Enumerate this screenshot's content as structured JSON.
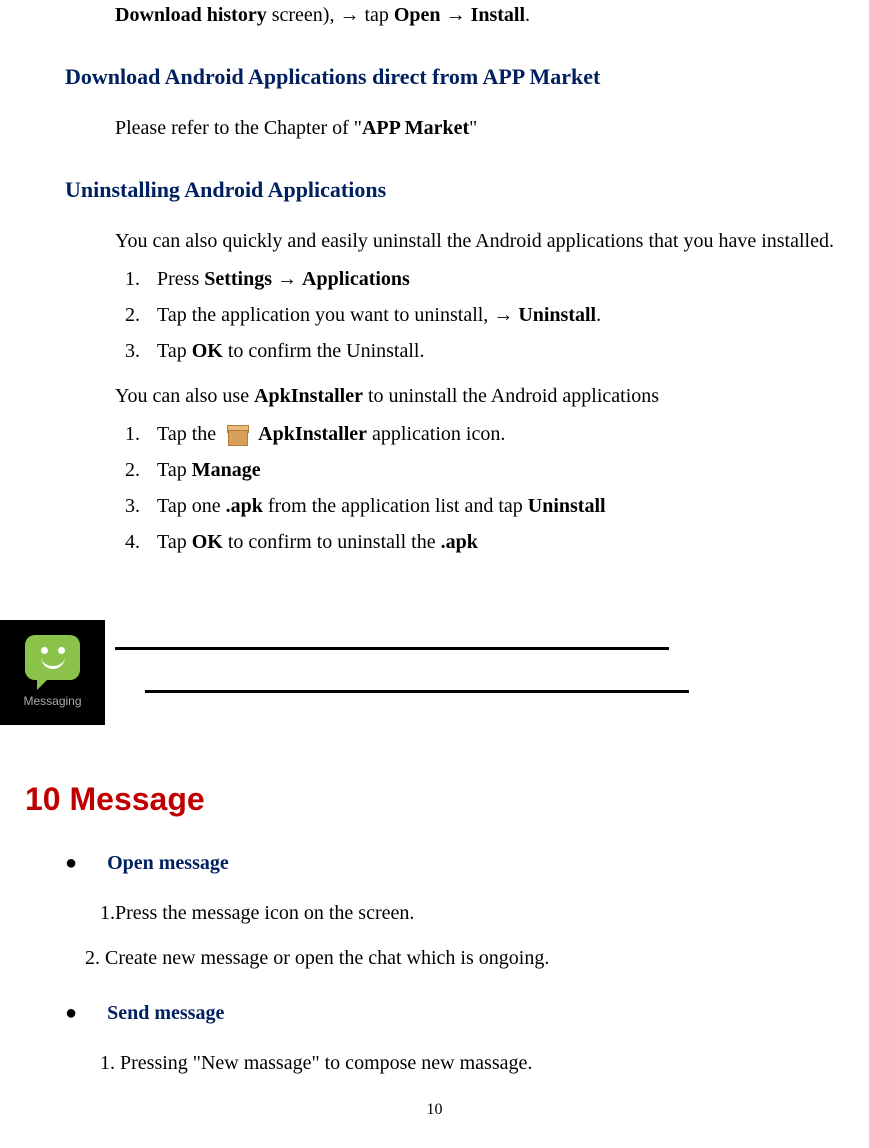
{
  "top_line": {
    "bold1": "Download history",
    "text1": " screen),  ",
    "arrow1": "→",
    "text2": "  tap ",
    "bold2": "Open",
    "text3": "  ",
    "arrow2": "→",
    "text4": "  ",
    "bold3": "Install",
    "text5": "."
  },
  "section1": {
    "heading": "Download Android Applications direct from APP Market",
    "body_pre": "Please refer to the Chapter of \"",
    "body_bold": "APP Market",
    "body_post": "\""
  },
  "section2": {
    "heading": "Uninstalling Android Applications",
    "intro": "You can also quickly and easily uninstall the Android applications that you have installed.",
    "list1": [
      {
        "num": "1.",
        "pre": "Press ",
        "b1": "Settings",
        "mid": "  ",
        "arrow": "→",
        "mid2": "  ",
        "b2": "Applications",
        "post": ""
      },
      {
        "num": "2.",
        "pre": "Tap the application you want to uninstall,  ",
        "arrow": "→",
        "mid2": "  ",
        "b2": "Uninstall",
        "post": "."
      },
      {
        "num": "3.",
        "pre": "Tap ",
        "b1": "OK",
        "post": " to confirm the Uninstall."
      }
    ],
    "intro2_pre": "You can also use ",
    "intro2_bold": "ApkInstaller",
    "intro2_post": " to uninstall the Android applications",
    "list2": [
      {
        "num": "1.",
        "pre": "Tap the ",
        "icon": true,
        "b1": "ApkInstaller",
        "post": " application icon."
      },
      {
        "num": "2.",
        "pre": "Tap ",
        "b1": "Manage",
        "post": ""
      },
      {
        "num": "3.",
        "pre": "Tap one ",
        "b1": ".apk",
        "mid": " from the application list and tap ",
        "b2": "Uninstall",
        "post": ""
      },
      {
        "num": "4.",
        "pre": "Tap ",
        "b1": "OK",
        "mid": " to confirm to uninstall the ",
        "b2": ".apk",
        "post": ""
      }
    ]
  },
  "messaging_icon_label": "Messaging",
  "chapter": {
    "heading": "10   Message",
    "sub1": "Open message",
    "sub1_items": [
      "1.Press the message icon on the screen.",
      "2. Create new message or open the chat which is ongoing."
    ],
    "sub2": "Send message",
    "sub2_items": [
      "1. Pressing \"New massage\" to compose new massage."
    ]
  },
  "page_number": "10"
}
